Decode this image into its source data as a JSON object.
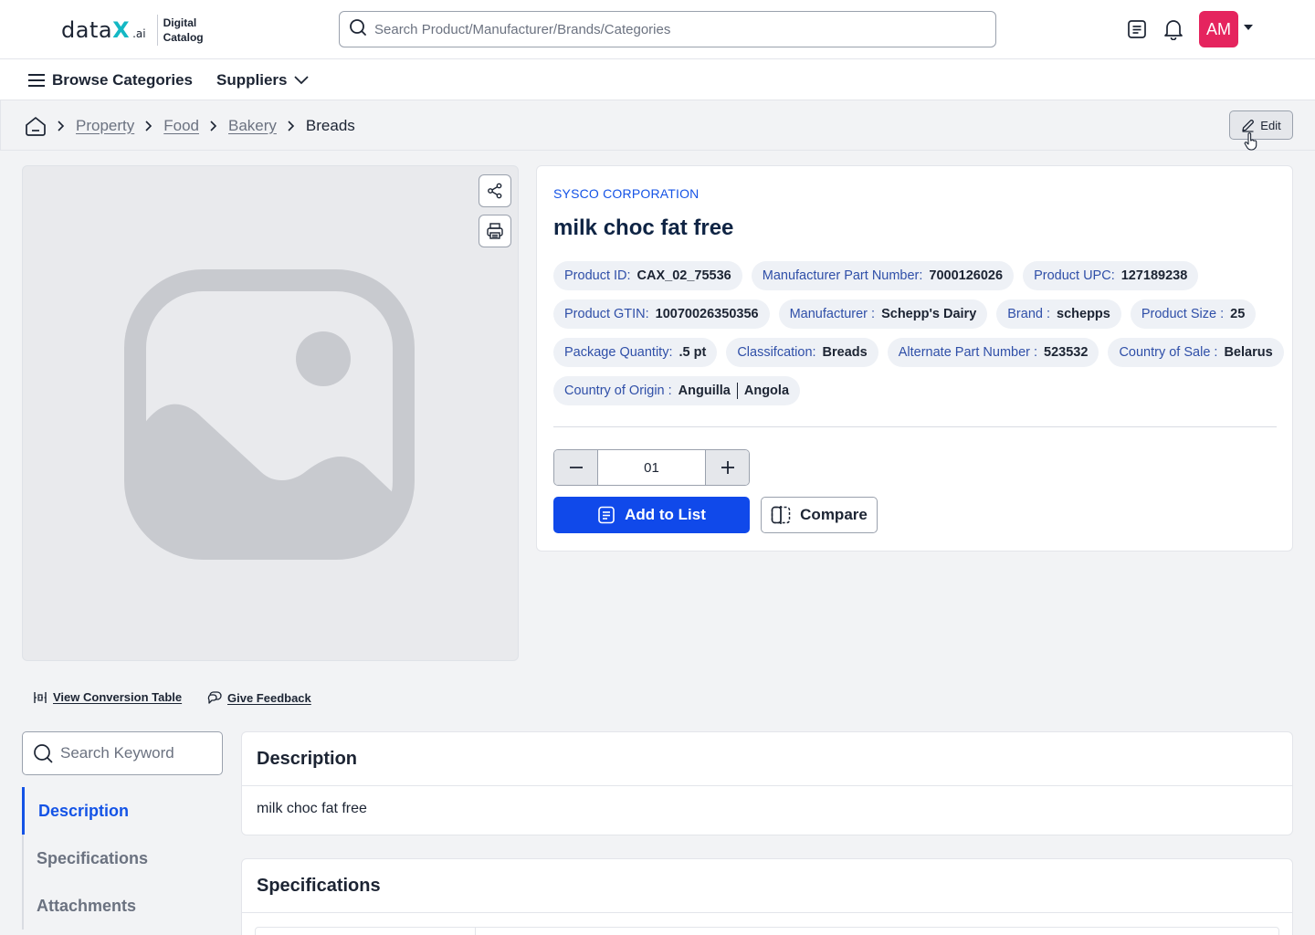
{
  "header": {
    "logo_text": "data",
    "logo_x": "X",
    "logo_suffix": ".ai",
    "logo_sub_1": "Digital",
    "logo_sub_2": "Catalog",
    "search_placeholder": "Search Product/Manufacturer/Brands/Categories",
    "avatar_initials": "AM",
    "avatar_color": "#e5245e"
  },
  "nav": {
    "browse_label": "Browse Categories",
    "suppliers_label": "Suppliers"
  },
  "breadcrumb": {
    "items": [
      "Property",
      "Food",
      "Bakery"
    ],
    "current": "Breads"
  },
  "edit_label": "Edit",
  "product": {
    "manufacturer": "SYSCO CORPORATION",
    "title": "milk choc fat free",
    "attributes": [
      {
        "key": "Product ID:",
        "value": "CAX_02_75536"
      },
      {
        "key": "Manufacturer Part Number:",
        "value": "7000126026"
      },
      {
        "key": "Product UPC:",
        "value": "127189238"
      },
      {
        "key": "Product GTIN:",
        "value": "10070026350356"
      },
      {
        "key": "Manufacturer :",
        "value": "Schepp's Dairy"
      },
      {
        "key": "Brand :",
        "value": "schepps"
      },
      {
        "key": "Product Size :",
        "value": "25"
      },
      {
        "key": "Package Quantity:",
        "value": ".5 pt"
      },
      {
        "key": "Classifcation:",
        "value": "Breads"
      },
      {
        "key": "Alternate Part Number :",
        "value": "523532"
      },
      {
        "key": "Country of Sale :",
        "value": "Belarus"
      }
    ],
    "origin": {
      "key": "Country of Origin :",
      "values": [
        "Anguilla",
        "Angola"
      ]
    },
    "quantity": "01",
    "add_to_list_label": "Add to List",
    "compare_label": "Compare",
    "accent_color": "#1049ea"
  },
  "links": {
    "conversion": "View Conversion Table",
    "feedback": "Give Feedback"
  },
  "sidebar": {
    "search_placeholder": "Search Keyword",
    "items": [
      {
        "label": "Description",
        "active": true
      },
      {
        "label": "Specifications",
        "active": false
      },
      {
        "label": "Attachments",
        "active": false
      }
    ]
  },
  "sections": {
    "description": {
      "title": "Description",
      "text": "milk choc fat free"
    },
    "specifications": {
      "title": "Specifications"
    }
  }
}
